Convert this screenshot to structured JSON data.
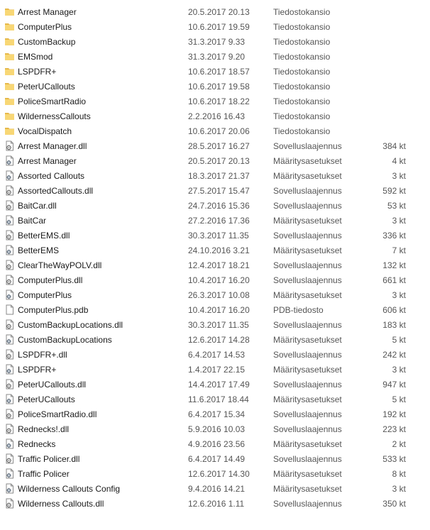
{
  "files": [
    {
      "name": "Arrest Manager",
      "date": "20.5.2017 20.13",
      "type": "Tiedostokansio",
      "size": "",
      "icon": "folder-icon"
    },
    {
      "name": "ComputerPlus",
      "date": "10.6.2017 19.59",
      "type": "Tiedostokansio",
      "size": "",
      "icon": "folder-icon"
    },
    {
      "name": "CustomBackup",
      "date": "31.3.2017 9.33",
      "type": "Tiedostokansio",
      "size": "",
      "icon": "folder-icon"
    },
    {
      "name": "EMSmod",
      "date": "31.3.2017 9.20",
      "type": "Tiedostokansio",
      "size": "",
      "icon": "folder-icon"
    },
    {
      "name": "LSPDFR+",
      "date": "10.6.2017 18.57",
      "type": "Tiedostokansio",
      "size": "",
      "icon": "folder-icon"
    },
    {
      "name": "PeterUCallouts",
      "date": "10.6.2017 19.58",
      "type": "Tiedostokansio",
      "size": "",
      "icon": "folder-icon"
    },
    {
      "name": "PoliceSmartRadio",
      "date": "10.6.2017 18.22",
      "type": "Tiedostokansio",
      "size": "",
      "icon": "folder-icon"
    },
    {
      "name": "WildernessCallouts",
      "date": "2.2.2016 16.43",
      "type": "Tiedostokansio",
      "size": "",
      "icon": "folder-icon"
    },
    {
      "name": "VocalDispatch",
      "date": "10.6.2017 20.06",
      "type": "Tiedostokansio",
      "size": "",
      "icon": "folder-icon"
    },
    {
      "name": "Arrest Manager.dll",
      "date": "28.5.2017 16.27",
      "type": "Sovelluslaajennus",
      "size": "384 kt",
      "icon": "dll-icon"
    },
    {
      "name": "Arrest Manager",
      "date": "20.5.2017 20.13",
      "type": "Määritysasetukset",
      "size": "4 kt",
      "icon": "config-icon"
    },
    {
      "name": "Assorted Callouts",
      "date": "18.3.2017 21.37",
      "type": "Määritysasetukset",
      "size": "3 kt",
      "icon": "config-icon"
    },
    {
      "name": "AssortedCallouts.dll",
      "date": "27.5.2017 15.47",
      "type": "Sovelluslaajennus",
      "size": "592 kt",
      "icon": "dll-icon"
    },
    {
      "name": "BaitCar.dll",
      "date": "24.7.2016 15.36",
      "type": "Sovelluslaajennus",
      "size": "53 kt",
      "icon": "dll-icon"
    },
    {
      "name": "BaitCar",
      "date": "27.2.2016 17.36",
      "type": "Määritysasetukset",
      "size": "3 kt",
      "icon": "config-icon"
    },
    {
      "name": "BetterEMS.dll",
      "date": "30.3.2017 11.35",
      "type": "Sovelluslaajennus",
      "size": "336 kt",
      "icon": "dll-icon"
    },
    {
      "name": "BetterEMS",
      "date": "24.10.2016 3.21",
      "type": "Määritysasetukset",
      "size": "7 kt",
      "icon": "config-icon"
    },
    {
      "name": "ClearTheWayPOLV.dll",
      "date": "12.4.2017 18.21",
      "type": "Sovelluslaajennus",
      "size": "132 kt",
      "icon": "dll-icon"
    },
    {
      "name": "ComputerPlus.dll",
      "date": "10.4.2017 16.20",
      "type": "Sovelluslaajennus",
      "size": "661 kt",
      "icon": "dll-icon"
    },
    {
      "name": "ComputerPlus",
      "date": "26.3.2017 10.08",
      "type": "Määritysasetukset",
      "size": "3 kt",
      "icon": "config-icon"
    },
    {
      "name": "ComputerPlus.pdb",
      "date": "10.4.2017 16.20",
      "type": "PDB-tiedosto",
      "size": "606 kt",
      "icon": "blank-file-icon"
    },
    {
      "name": "CustomBackupLocations.dll",
      "date": "30.3.2017 11.35",
      "type": "Sovelluslaajennus",
      "size": "183 kt",
      "icon": "dll-icon"
    },
    {
      "name": "CustomBackupLocations",
      "date": "12.6.2017 14.28",
      "type": "Määritysasetukset",
      "size": "5 kt",
      "icon": "config-icon"
    },
    {
      "name": "LSPDFR+.dll",
      "date": "6.4.2017 14.53",
      "type": "Sovelluslaajennus",
      "size": "242 kt",
      "icon": "dll-icon"
    },
    {
      "name": "LSPDFR+",
      "date": "1.4.2017 22.15",
      "type": "Määritysasetukset",
      "size": "3 kt",
      "icon": "config-icon"
    },
    {
      "name": "PeterUCallouts.dll",
      "date": "14.4.2017 17.49",
      "type": "Sovelluslaajennus",
      "size": "947 kt",
      "icon": "dll-icon"
    },
    {
      "name": "PeterUCallouts",
      "date": "11.6.2017 18.44",
      "type": "Määritysasetukset",
      "size": "5 kt",
      "icon": "config-icon"
    },
    {
      "name": "PoliceSmartRadio.dll",
      "date": "6.4.2017 15.34",
      "type": "Sovelluslaajennus",
      "size": "192 kt",
      "icon": "dll-icon"
    },
    {
      "name": "Rednecks!.dll",
      "date": "5.9.2016 10.03",
      "type": "Sovelluslaajennus",
      "size": "223 kt",
      "icon": "dll-icon"
    },
    {
      "name": "Rednecks",
      "date": "4.9.2016 23.56",
      "type": "Määritysasetukset",
      "size": "2 kt",
      "icon": "config-icon"
    },
    {
      "name": "Traffic Policer.dll",
      "date": "6.4.2017 14.49",
      "type": "Sovelluslaajennus",
      "size": "533 kt",
      "icon": "dll-icon"
    },
    {
      "name": "Traffic Policer",
      "date": "12.6.2017 14.30",
      "type": "Määritysasetukset",
      "size": "8 kt",
      "icon": "config-icon"
    },
    {
      "name": "Wilderness Callouts Config",
      "date": "9.4.2016 14.21",
      "type": "Määritysasetukset",
      "size": "3 kt",
      "icon": "config-icon"
    },
    {
      "name": "Wilderness Callouts.dll",
      "date": "12.6.2016 1.11",
      "type": "Sovelluslaajennus",
      "size": "350 kt",
      "icon": "dll-icon"
    }
  ],
  "colors": {
    "folder": "#f8d775",
    "folder_dark": "#e6b84a",
    "file_border": "#8a8a8a"
  }
}
